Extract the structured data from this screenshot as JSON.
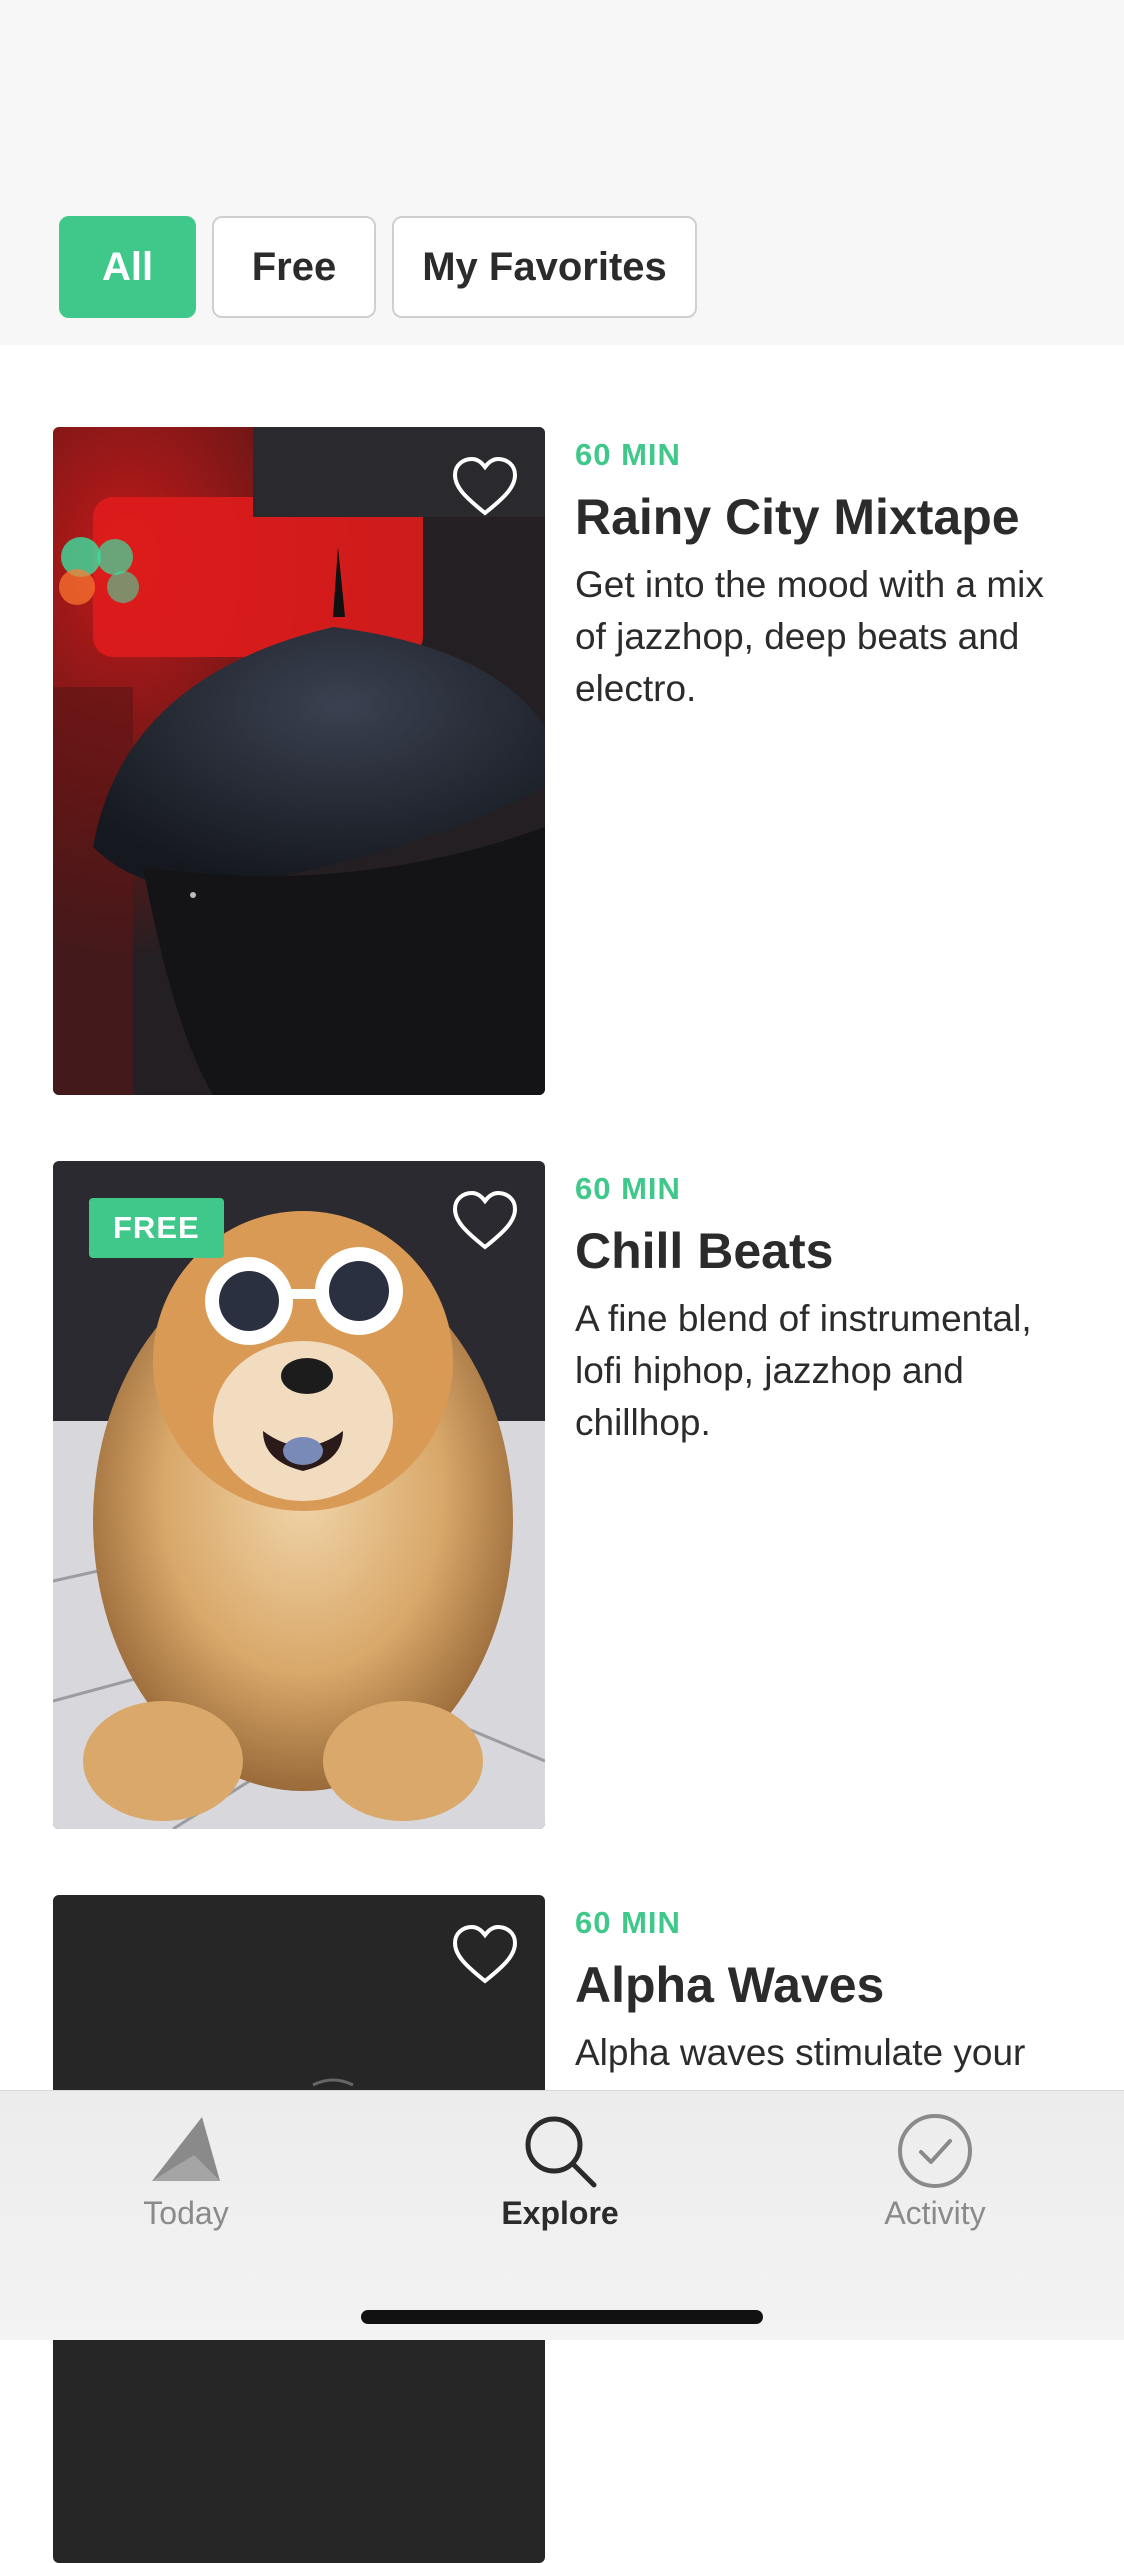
{
  "filters": {
    "all": "All",
    "free": "Free",
    "favorites": "My Favorites",
    "active": "All"
  },
  "cards": [
    {
      "duration": "60 MIN",
      "title": "Rainy City Mixtape",
      "description": "Get into the mood with a mix of jazzhop, deep beats and electro.",
      "image": "umbrella-in-rainy-city-photo",
      "free": false
    },
    {
      "duration": "60 MIN",
      "title": "Chill Beats",
      "description": "A fine blend of instrumental, lofi hiphop, jazzhop and chillhop.",
      "image": "dog-with-white-sunglasses-photo",
      "free": true,
      "badge": "FREE"
    },
    {
      "duration": "60 MIN",
      "title": "Alpha Waves",
      "description": "Alpha waves stimulate your",
      "image": "dark-photo",
      "free": false
    }
  ],
  "tabbar": {
    "today": "Today",
    "explore": "Explore",
    "activity": "Activity",
    "active": "Explore"
  },
  "colors": {
    "accent": "#3fc88a",
    "text": "#2b2b2b",
    "muted": "#8a8a8a"
  },
  "icons": [
    "heart-icon",
    "today-icon",
    "search-icon",
    "check-circle-icon"
  ]
}
